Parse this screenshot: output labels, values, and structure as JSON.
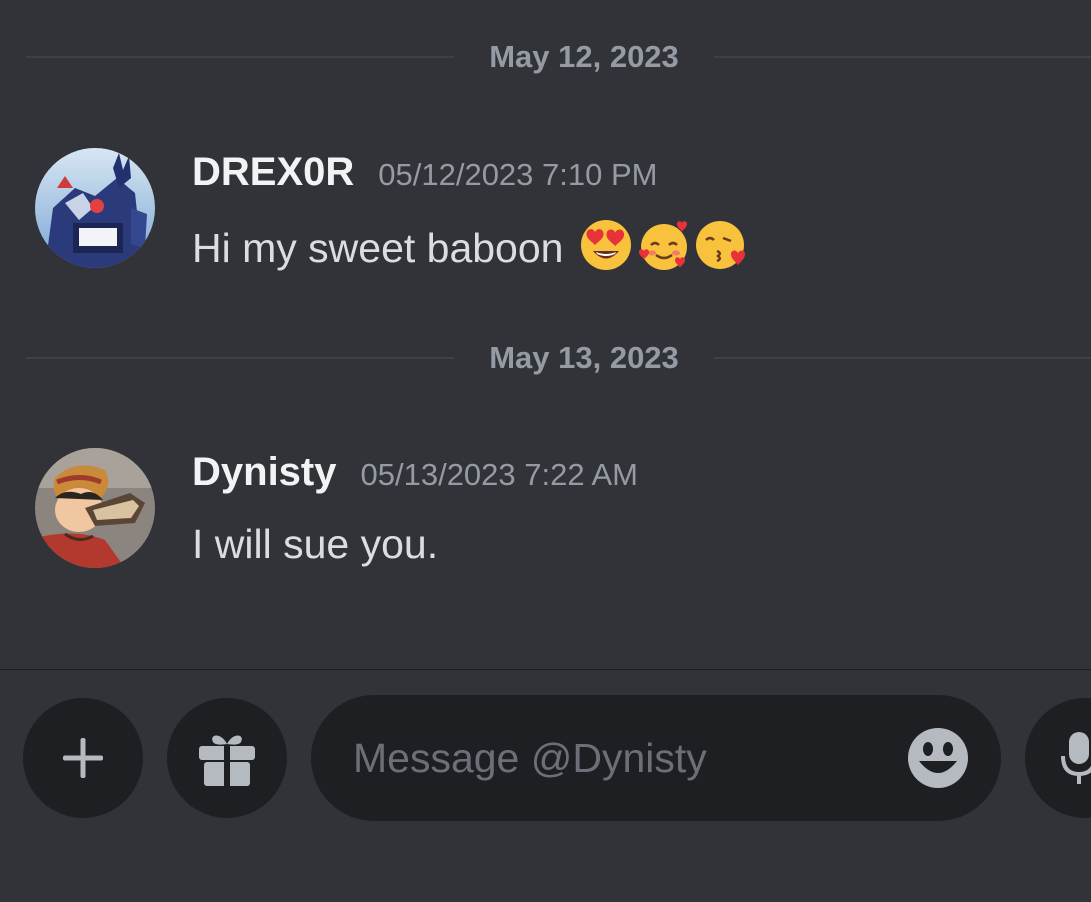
{
  "messages_section": {
    "dividers": [
      {
        "date": "May 12, 2023"
      },
      {
        "date": "May 13, 2023"
      }
    ],
    "messages": [
      {
        "username": "DREX0R",
        "timestamp": "05/12/2023 7:10 PM",
        "text": "Hi my sweet baboon",
        "emojis": [
          "heart-eyes-emoji",
          "smiling-face-with-hearts-emoji",
          "face-blowing-kiss-emoji"
        ]
      },
      {
        "username": "Dynisty",
        "timestamp": "05/13/2023 7:22 AM",
        "text": "I will sue you."
      }
    ]
  },
  "composer": {
    "add_icon": "plus-icon",
    "gift_icon": "gift-icon",
    "placeholder": "Message @Dynisty",
    "emoji_icon": "emoji-smile-icon",
    "mic_icon": "microphone-icon"
  },
  "colors": {
    "background": "#313338",
    "input_background": "#1e1f22",
    "muted_text": "#949ba4",
    "username": "#f2f3f5"
  }
}
